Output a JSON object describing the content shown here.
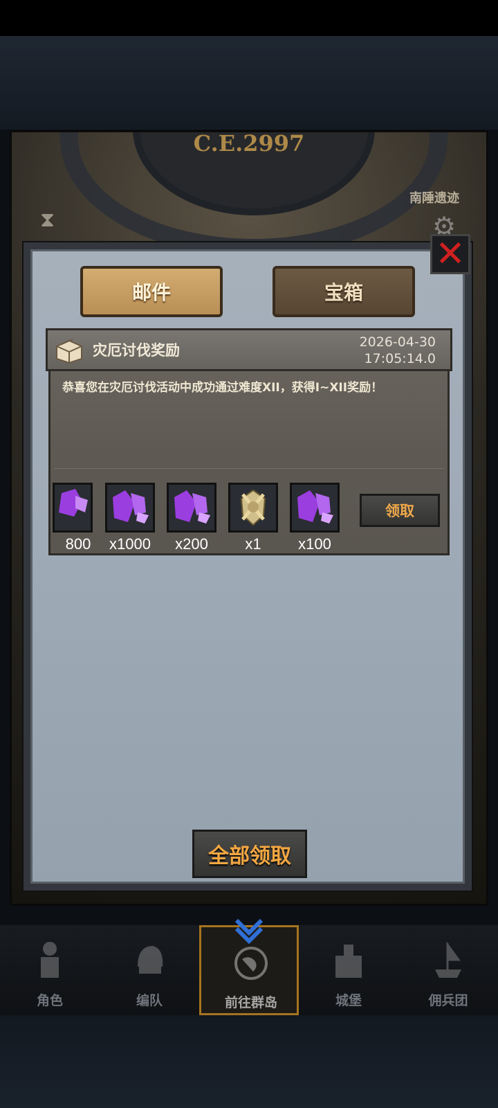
{
  "background": {
    "era_label": "C.E.2997",
    "map_label": "南陲遗迹"
  },
  "tabs": [
    {
      "label": "邮件",
      "active": true
    },
    {
      "label": "宝箱",
      "active": false
    }
  ],
  "mail": {
    "title": "灾厄讨伐奖励",
    "date": "2026-04-30",
    "time": "17:05:14.0",
    "body": "恭喜您在灾厄讨伐活动中成功通过难度XII，获得I~XII奖励！",
    "rewards": [
      {
        "icon": "purple-crystal-icon",
        "qty": "800"
      },
      {
        "icon": "purple-crystal-icon",
        "qty": "x1000"
      },
      {
        "icon": "purple-crystal-icon",
        "qty": "x200"
      },
      {
        "icon": "golden-crest-icon",
        "qty": "x1"
      },
      {
        "icon": "purple-crystal-icon",
        "qty": "x100"
      }
    ],
    "claim_label": "领取"
  },
  "claim_all_label": "全部领取",
  "nav": [
    {
      "label": "角色",
      "icon": "knight-icon"
    },
    {
      "label": "编队",
      "icon": "helmet-icon"
    },
    {
      "label": "前往群岛",
      "icon": "globe-icon",
      "active": true
    },
    {
      "label": "城堡",
      "icon": "castle-icon"
    },
    {
      "label": "佣兵团",
      "icon": "ship-icon"
    }
  ],
  "colors": {
    "accent_orange": "#f3a742",
    "close_red": "#d02020",
    "crystal_purple": "#9b3ee0"
  }
}
